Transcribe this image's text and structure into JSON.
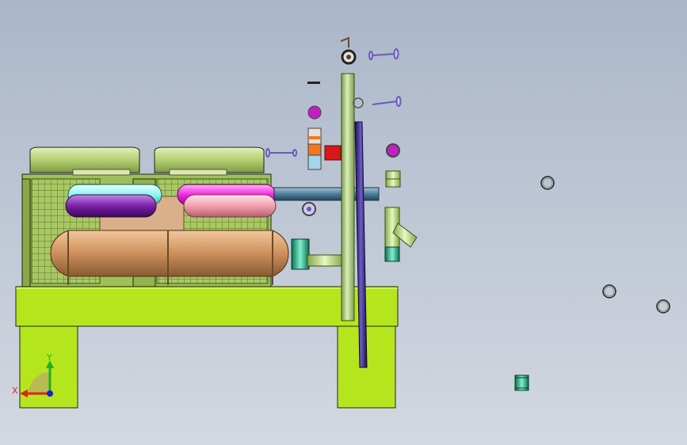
{
  "viewport": {
    "mode": "cad-3d-model-view",
    "view": "front"
  },
  "triad": {
    "x_label": "X",
    "y_label": "Y",
    "x_color": "#e02020",
    "y_color": "#20b020",
    "z_color": "#2020d0"
  },
  "colors": {
    "frame": "#b5e61d",
    "frame_dark": "#7fa010",
    "fan_housing": "#b9d27a",
    "grille": "#8fb24a",
    "receiver_tank": "#d39a66",
    "upper_bay": "#d9b08a",
    "vessel_purple": "#7b1fa8",
    "vessel_cyan": "#8ff3f0",
    "vessel_magenta": "#f028e0",
    "vessel_pink": "#f3a0b0",
    "riser_pipe": "#b4d68a",
    "diagonal_pipe": "#3b2b8a",
    "header_pipe": "#4e7d9a",
    "teal_fitting": "#1fb98c",
    "red_valve": "#d81818",
    "orange_band": "#f07820",
    "magenta_part": "#c020c0",
    "outline": "#222222"
  },
  "loose_parts": [
    {
      "name": "ring-part-1",
      "kind": "ring"
    },
    {
      "name": "ring-part-2",
      "kind": "ring"
    },
    {
      "name": "ring-part-3",
      "kind": "ring"
    },
    {
      "name": "coupling-part",
      "kind": "teal-coupling"
    }
  ]
}
